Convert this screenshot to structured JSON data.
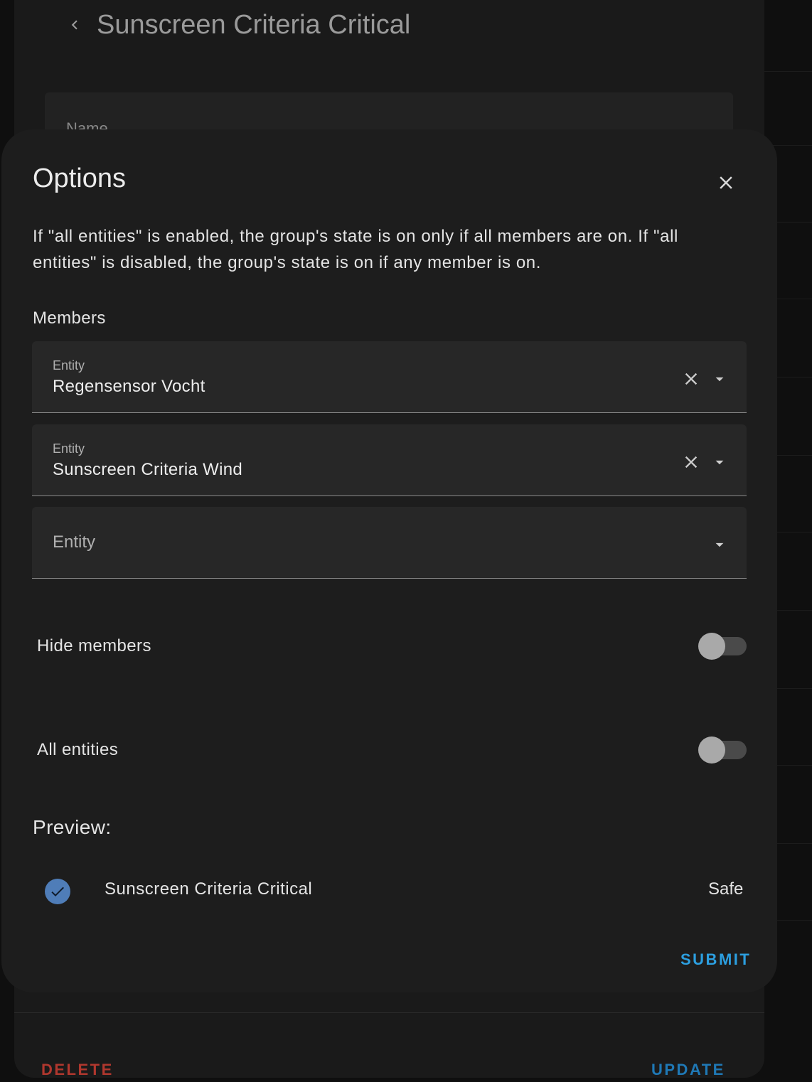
{
  "base_dialog": {
    "title": "Sunscreen Criteria Critical",
    "name_field_label": "Name",
    "delete_label": "DELETE",
    "update_label": "UPDATE"
  },
  "options_dialog": {
    "title": "Options",
    "description": "If \"all entities\" is enabled, the group's state is on only if all members are on. If \"all entities\" is disabled, the group's state is on if any member is on.",
    "members_label": "Members",
    "members": [
      {
        "label": "Entity",
        "value": "Regensensor Vocht"
      },
      {
        "label": "Entity",
        "value": "Sunscreen Criteria Wind"
      }
    ],
    "new_member_placeholder": "Entity",
    "hide_members": {
      "label": "Hide members",
      "enabled": false
    },
    "all_entities": {
      "label": "All entities",
      "enabled": false
    },
    "preview_label": "Preview:",
    "preview": {
      "name": "Sunscreen Criteria Critical",
      "state": "Safe",
      "icon": "check-circle-icon"
    },
    "submit_label": "SUBMIT"
  },
  "colors": {
    "accent": "#2c9fe0",
    "update": "#1f78b5",
    "delete": "#b0372e",
    "preview_icon": "#4f7db8"
  }
}
